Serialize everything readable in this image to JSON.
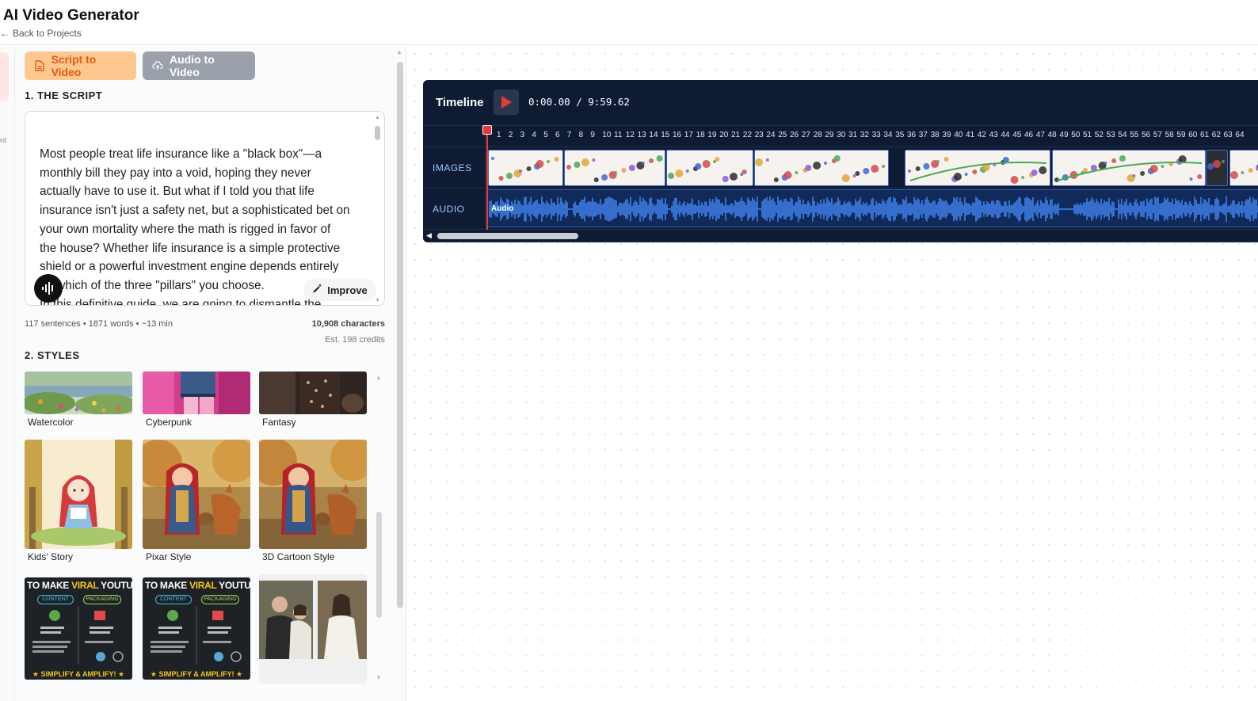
{
  "header": {
    "title": "AI Video Generator",
    "back_label": "Back to Projects"
  },
  "edge": {
    "label": "rd"
  },
  "tabs": {
    "script_to_video": "Script to Video",
    "audio_to_video": "Audio to Video"
  },
  "script_section": {
    "heading": "1. THE SCRIPT",
    "text_lines": [
      "Most people treat life insurance like a \"black box\"—a",
      "monthly bill they pay into a void, hoping they never",
      "actually have to use it. But what if I told you that life",
      "insurance isn't just a safety net, but a sophisticated bet on",
      "your own mortality where the math is rigged in favor of",
      "the house? Whether life insurance is a simple protective",
      "shield or a powerful investment engine depends entirely",
      "on which of the three \"pillars\" you choose.",
      "In this definitive guide, we are going to dismantle the"
    ],
    "improve_label": "Improve",
    "stats": "117 sentences • 1871 words • ~13 min",
    "characters": "10,908 characters",
    "credits": "Est. 198 credits"
  },
  "styles_section": {
    "heading": "2. STYLES",
    "items": [
      {
        "label": "Watercolor"
      },
      {
        "label": "Cyberpunk"
      },
      {
        "label": "Fantasy"
      },
      {
        "label": "Kids' Story"
      },
      {
        "label": "Pixar Style"
      },
      {
        "label": "3D Cartoon Style"
      },
      {
        "label": ""
      },
      {
        "label": ""
      },
      {
        "label": ""
      }
    ],
    "poster_title_1": "TO MAKE ",
    "poster_title_viral": "VIRAL",
    "poster_title_2": " YOUTUBE VI",
    "poster_content": "CONTENT",
    "poster_packaging": "PACKAGING",
    "poster_footer": "★ SIMPLIFY & AMPLIFY! ★"
  },
  "timeline": {
    "title": "Timeline",
    "time": "0:00.00 / 9:59.62",
    "images_label": "IMAGES",
    "audio_label": "AUDIO",
    "audio_clip_label": "Audio",
    "ticks": [
      "1",
      "2",
      "3",
      "4",
      "5",
      "6",
      "7",
      "8",
      "9",
      "10",
      "11",
      "12",
      "13",
      "14",
      "15",
      "16",
      "17",
      "18",
      "19",
      "20",
      "21",
      "22",
      "23",
      "24",
      "25",
      "26",
      "27",
      "28",
      "29",
      "30",
      "31",
      "32",
      "33",
      "34",
      "35",
      "36",
      "37",
      "38",
      "39",
      "40",
      "41",
      "42",
      "43",
      "44",
      "45",
      "46",
      "47",
      "48",
      "49",
      "50",
      "51",
      "52",
      "53",
      "54",
      "55",
      "56",
      "57",
      "58",
      "59",
      "60",
      "61",
      "62",
      "63",
      "64"
    ]
  },
  "colors": {
    "accent_orange": "#e25a12",
    "tab_active_bg": "#fcc890",
    "timeline_bg": "#0f1b33",
    "waveform": "#3f7fe8",
    "playhead": "#e53935"
  }
}
